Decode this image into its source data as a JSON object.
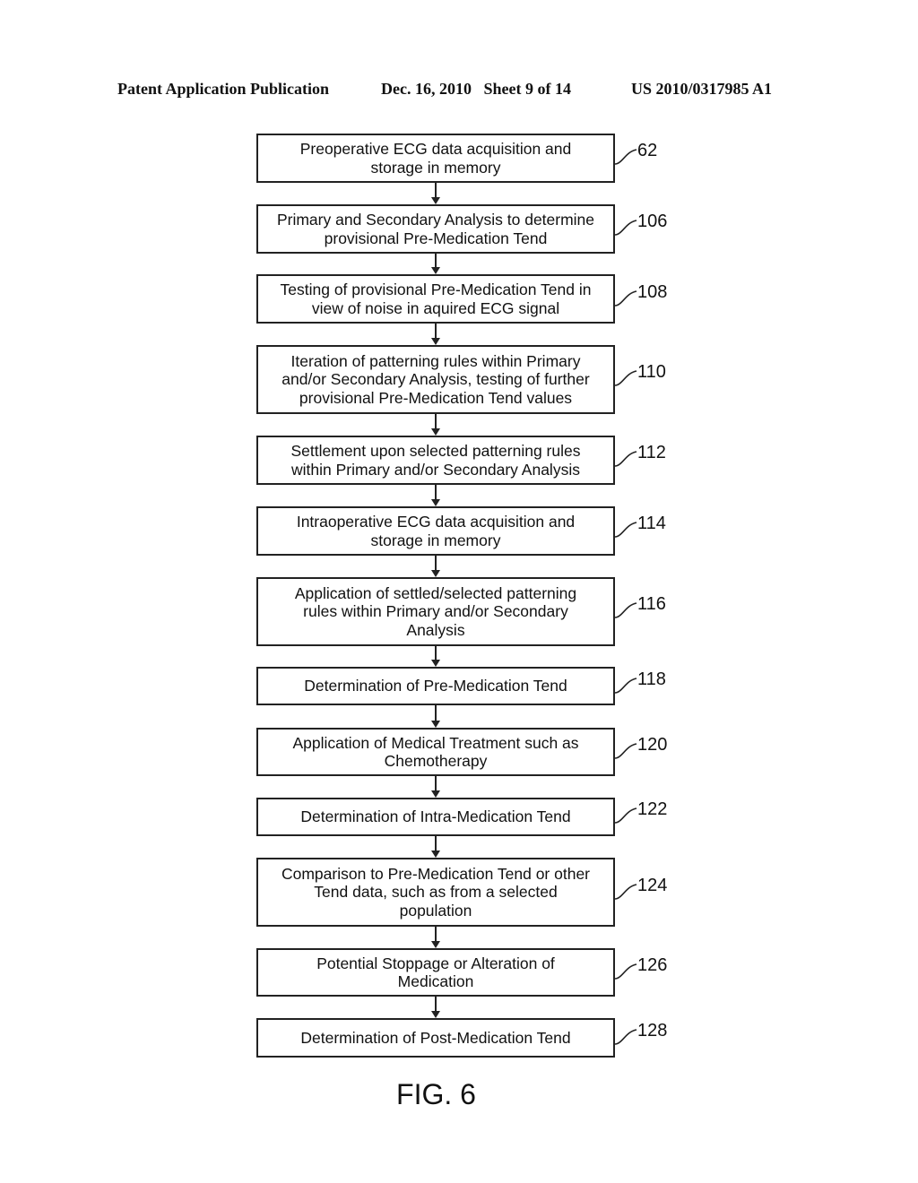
{
  "header": {
    "publication": "Patent Application Publication",
    "date_sheet": "Dec. 16, 2010   Sheet 9 of 14",
    "number": "US 2010/0317985 A1"
  },
  "steps": [
    {
      "ref": "62",
      "text": "Preoperative ECG data acquisition and\nstorage in memory"
    },
    {
      "ref": "106",
      "text": "Primary and Secondary Analysis to determine\nprovisional Pre-Medication Tend"
    },
    {
      "ref": "108",
      "text": "Testing of provisional Pre-Medication Tend in\nview of noise in aquired ECG signal"
    },
    {
      "ref": "110",
      "text": "Iteration of patterning rules within Primary\nand/or Secondary Analysis, testing of further\nprovisional Pre-Medication Tend values"
    },
    {
      "ref": "112",
      "text": "Settlement upon selected patterning rules\nwithin Primary and/or Secondary Analysis"
    },
    {
      "ref": "114",
      "text": "Intraoperative ECG data acquisition and\nstorage in memory"
    },
    {
      "ref": "116",
      "text": "Application of settled/selected patterning\nrules within Primary and/or Secondary\nAnalysis"
    },
    {
      "ref": "118",
      "text": "Determination of Pre-Medication Tend"
    },
    {
      "ref": "120",
      "text": "Application of Medical Treatment such as\nChemotherapy"
    },
    {
      "ref": "122",
      "text": "Determination of Intra-Medication Tend"
    },
    {
      "ref": "124",
      "text": "Comparison to Pre-Medication Tend or other\nTend data, such as from a selected\npopulation"
    },
    {
      "ref": "126",
      "text": "Potential Stoppage or Alteration of\nMedication"
    },
    {
      "ref": "128",
      "text": "Determination of Post-Medication Tend"
    }
  ],
  "figure_label": "FIG. 6"
}
